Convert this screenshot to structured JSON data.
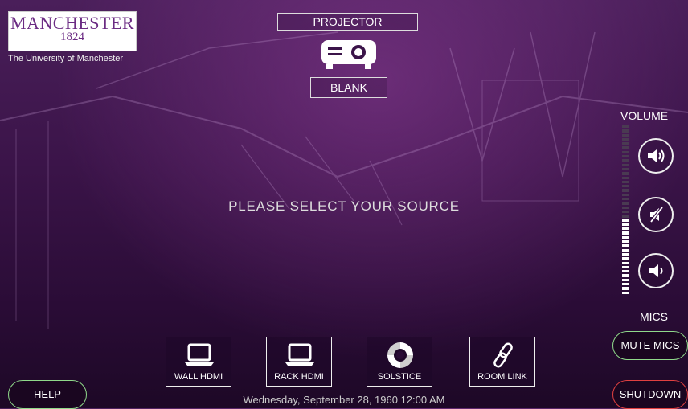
{
  "logo": {
    "name": "MANCHESTER",
    "year": "1824",
    "subtitle": "The University of Manchester"
  },
  "projector": {
    "label": "PROJECTOR",
    "icon": "projector-icon",
    "blank_label": "BLANK"
  },
  "message": "PLEASE SELECT YOUR SOURCE",
  "volume": {
    "label": "VOLUME",
    "level_fraction": 0.45,
    "buttons": {
      "up": "volume-up-icon",
      "mute": "volume-mute-icon",
      "down": "volume-down-icon"
    }
  },
  "mics": {
    "label": "MICS",
    "mute_label": "MUTE MICS"
  },
  "sources": [
    {
      "label": "WALL HDMI",
      "icon": "laptop-icon"
    },
    {
      "label": "RACK HDMI",
      "icon": "laptop-icon"
    },
    {
      "label": "SOLSTICE",
      "icon": "solstice-icon"
    },
    {
      "label": "ROOM LINK",
      "icon": "link-icon"
    }
  ],
  "help_label": "HELP",
  "shutdown_label": "SHUTDOWN",
  "datetime": "Wednesday, September 28, 1960 12:00 AM",
  "colors": {
    "accent_green": "#8fd98a",
    "accent_red": "#e04040",
    "brand_purple": "#6b2b83"
  }
}
